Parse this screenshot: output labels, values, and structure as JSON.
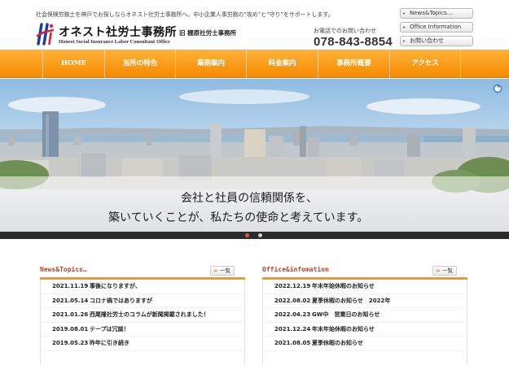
{
  "header": {
    "tagline": "社会保険労務士を神戸でお探しならオネスト社労士事務所へ。中小企業人事労務の“攻め”と“守り”をサポートします。",
    "logo_name": "オネスト社労士事務所",
    "logo_old": "旧 棚原社労士事務所",
    "logo_en": "Honest Social Insurance Labor Consultant Office",
    "phone_label": "お電話でのお問い合わせ",
    "phone": "078-843-8854",
    "util_links": [
      "News&Topics…",
      "Office Information",
      "お問い合わせ"
    ]
  },
  "nav": {
    "items": [
      "HOME",
      "当所の特色",
      "業務案内",
      "料金案内",
      "事務所概要",
      "アクセス"
    ]
  },
  "hero": {
    "line1": "会社と社員の信頼関係を、",
    "line2": "築いていくことが、私たちの使命と考えています。"
  },
  "news": {
    "title": "News&Topics…",
    "more": "一覧",
    "items": [
      {
        "date": "2021.11.19",
        "text": "事後になりますが、"
      },
      {
        "date": "2021.05.14",
        "text": "コロナ禍ではありますが"
      },
      {
        "date": "2021.01.26",
        "text": "西尾隆社労士のコラムが新聞掲載されました！"
      },
      {
        "date": "2019.08.01",
        "text": "テープは冗談！"
      },
      {
        "date": "2019.05.23",
        "text": "昨年に引き続き"
      }
    ]
  },
  "office": {
    "title": "Office&infomation",
    "more": "一覧",
    "items": [
      {
        "date": "2022.12.19",
        "text": "年末年始休暇のお知らせ"
      },
      {
        "date": "2022.08.02",
        "text": "夏季休暇のお知らせ　2022年"
      },
      {
        "date": "2022.04.23",
        "text": "GW中　営業日のお知らせ"
      },
      {
        "date": "2021.12.24",
        "text": "年末年始休暇のお知らせ"
      },
      {
        "date": "2021.08.05",
        "text": "夏季休暇のお知らせ"
      }
    ]
  },
  "colors": {
    "accent": "#f58a00",
    "title_red": "#c43d1c",
    "slider_active": "#e8553f"
  }
}
